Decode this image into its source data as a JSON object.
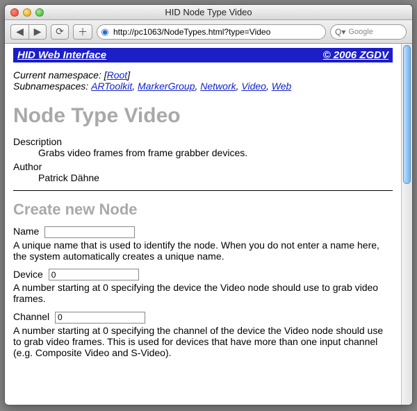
{
  "window": {
    "title": "HID Node Type Video"
  },
  "toolbar": {
    "back_glyph": "◀",
    "forward_glyph": "▶",
    "reload_glyph": "⟳",
    "add_glyph": "＋",
    "url": "http://pc1063/NodeTypes.html?type=Video",
    "search_placeholder": "Google",
    "search_prefix": "Q▾"
  },
  "banner": {
    "left": "HID Web Interface",
    "right": "© 2006 ZGDV"
  },
  "namespace": {
    "label": "Current namespace:",
    "root": "Root",
    "sub_label": "Subnamespaces:",
    "links": [
      "ARToolkit",
      "MarkerGroup",
      "Network",
      "Video",
      "Web"
    ]
  },
  "page_heading": "Node Type Video",
  "defs": {
    "desc_label": "Description",
    "desc_value": "Grabs video frames from frame grabber devices.",
    "author_label": "Author",
    "author_value": "Patrick Dähne"
  },
  "create_heading": "Create new Node",
  "fields": {
    "name": {
      "label": "Name",
      "value": "",
      "help": "A unique name that is used to identify the node. When you do not enter a name here, the system automatically creates a unique name."
    },
    "device": {
      "label": "Device",
      "value": "0",
      "help": "A number starting at 0 specifying the device the Video node should use to grab video frames."
    },
    "channel": {
      "label": "Channel",
      "value": "0",
      "help": "A number starting at 0 specifying the channel of the device the Video node should use to grab video frames. This is used for devices that have more than one input channel (e.g. Composite Video and S-Video)."
    }
  }
}
